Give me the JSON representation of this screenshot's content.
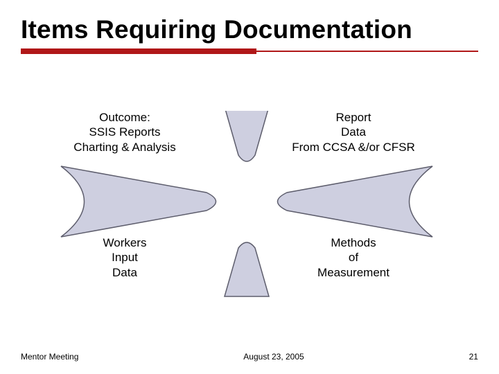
{
  "title": "Items Requiring Documentation",
  "labels": {
    "tl": {
      "l1": "Outcome:",
      "l2": "SSIS Reports",
      "l3": "Charting & Analysis"
    },
    "tr": {
      "l1": "Report",
      "l2": "Data",
      "l3": "From CCSA &/or CFSR"
    },
    "bl": {
      "l1": "Workers",
      "l2": "Input",
      "l3": "Data"
    },
    "br": {
      "l1": "Methods",
      "l2": "of",
      "l3": "Measurement"
    }
  },
  "footer": {
    "left": "Mentor Meeting",
    "center": "August 23, 2005",
    "right": "21"
  },
  "colors": {
    "accent": "#b01718",
    "shape_fill": "#cecfe0",
    "shape_stroke": "#5d5d6c"
  }
}
